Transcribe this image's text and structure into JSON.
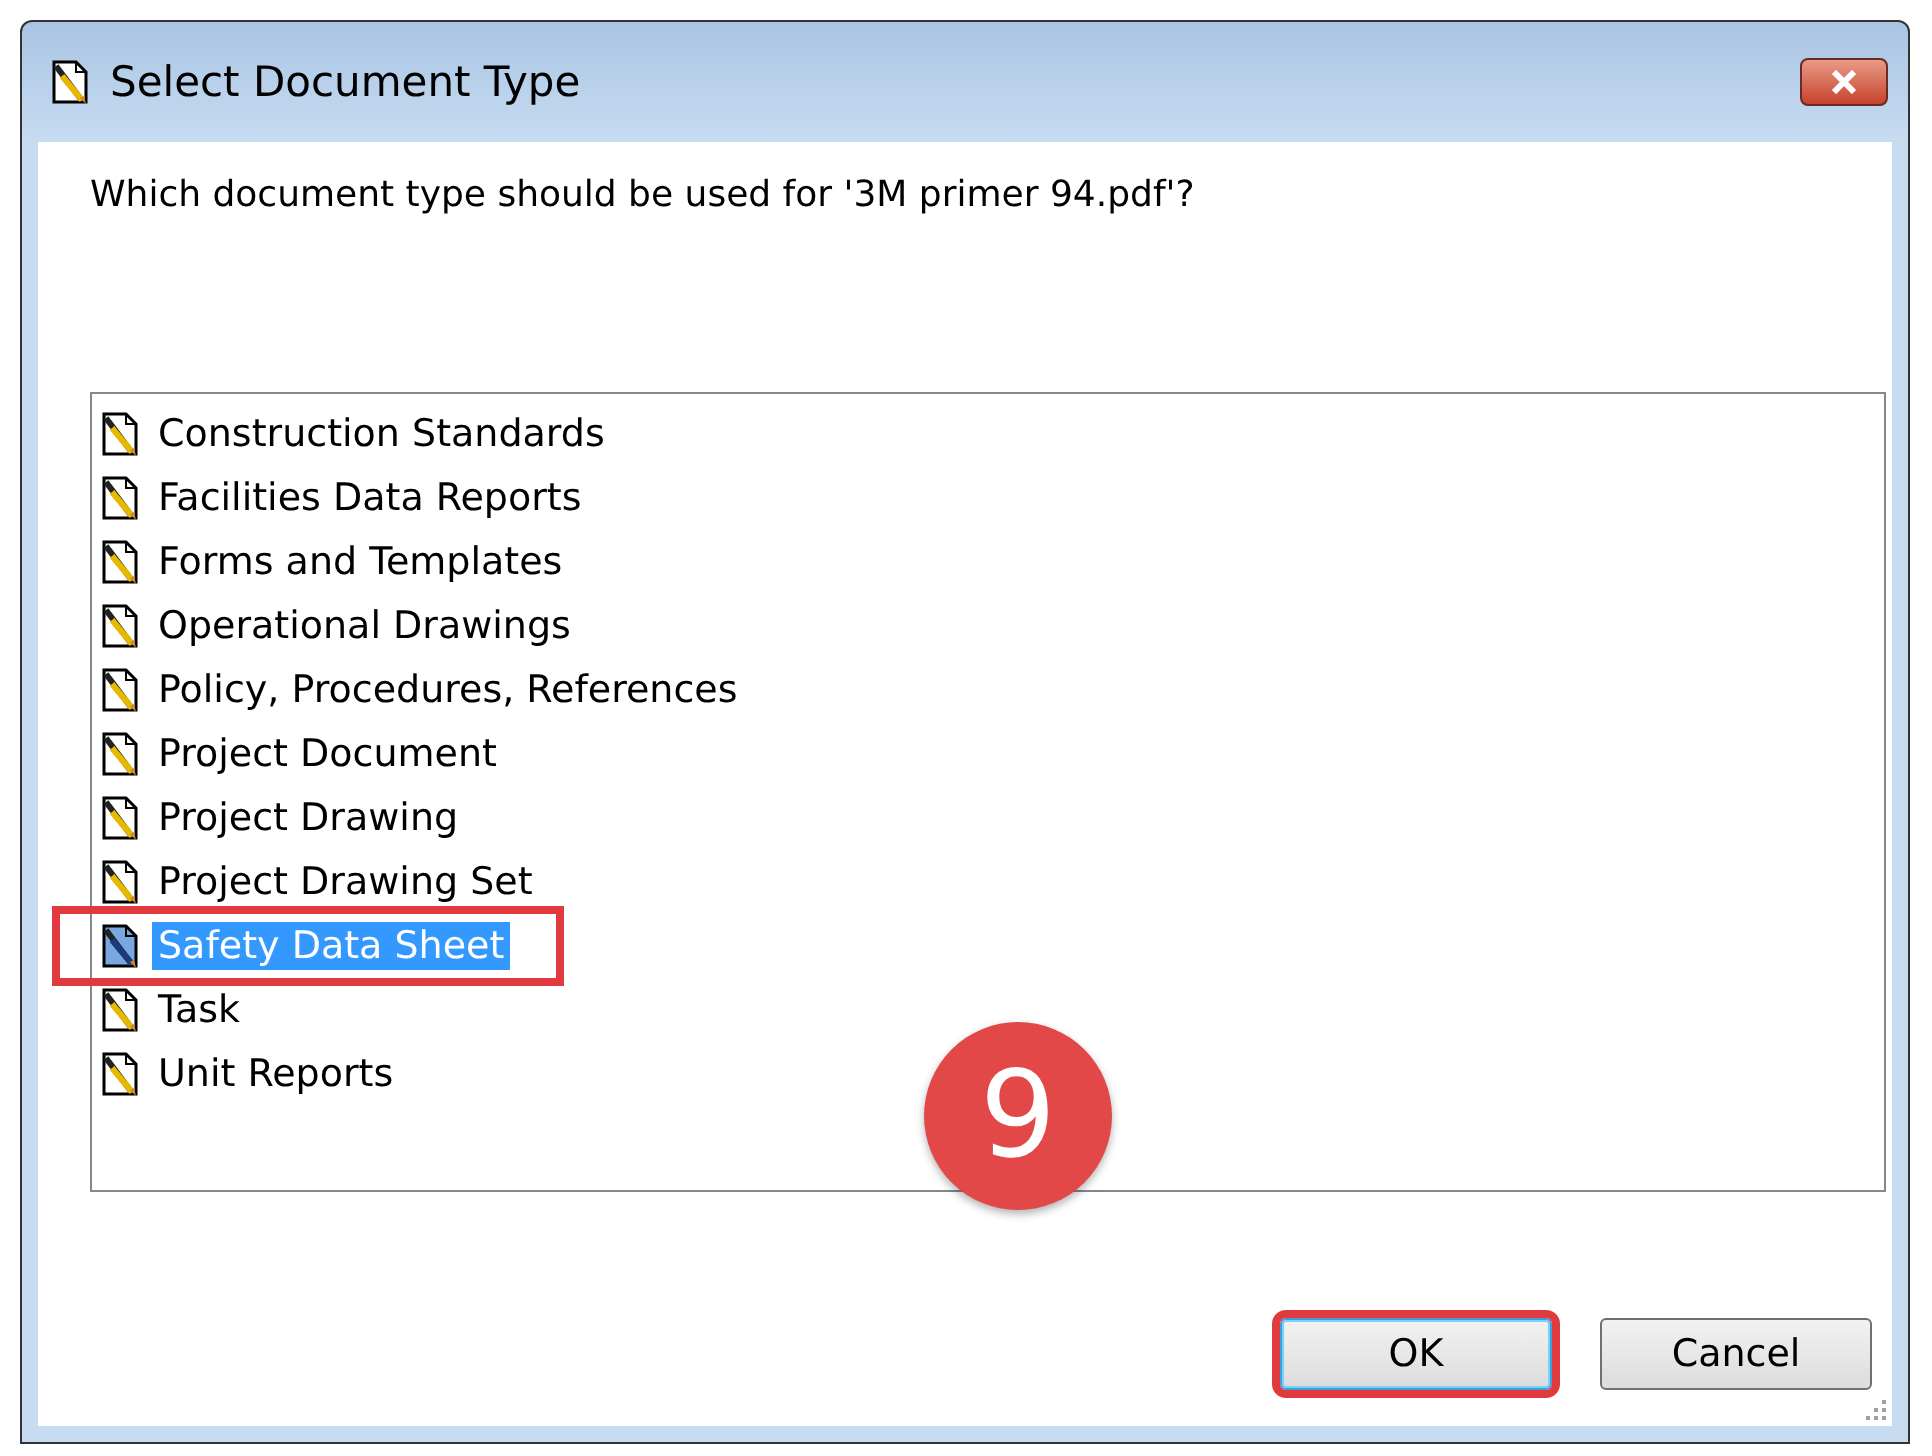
{
  "window": {
    "title": "Select Document Type"
  },
  "prompt": "Which document type should be used for '3M primer 94.pdf'?",
  "document_types": [
    {
      "label": "Construction Standards",
      "selected": false,
      "highlighted": false
    },
    {
      "label": "Facilities Data Reports",
      "selected": false,
      "highlighted": false
    },
    {
      "label": "Forms and Templates",
      "selected": false,
      "highlighted": false
    },
    {
      "label": "Operational Drawings",
      "selected": false,
      "highlighted": false
    },
    {
      "label": "Policy, Procedures, References",
      "selected": false,
      "highlighted": false
    },
    {
      "label": "Project Document",
      "selected": false,
      "highlighted": false
    },
    {
      "label": "Project Drawing",
      "selected": false,
      "highlighted": false
    },
    {
      "label": "Project Drawing Set",
      "selected": false,
      "highlighted": false
    },
    {
      "label": "Safety Data Sheet",
      "selected": true,
      "highlighted": true
    },
    {
      "label": "Task",
      "selected": false,
      "highlighted": false
    },
    {
      "label": "Unit Reports",
      "selected": false,
      "highlighted": false
    }
  ],
  "step_badge": "9",
  "buttons": [
    {
      "label": "OK",
      "highlighted": true,
      "default": true
    },
    {
      "label": "Cancel",
      "highlighted": false,
      "default": false
    }
  ]
}
